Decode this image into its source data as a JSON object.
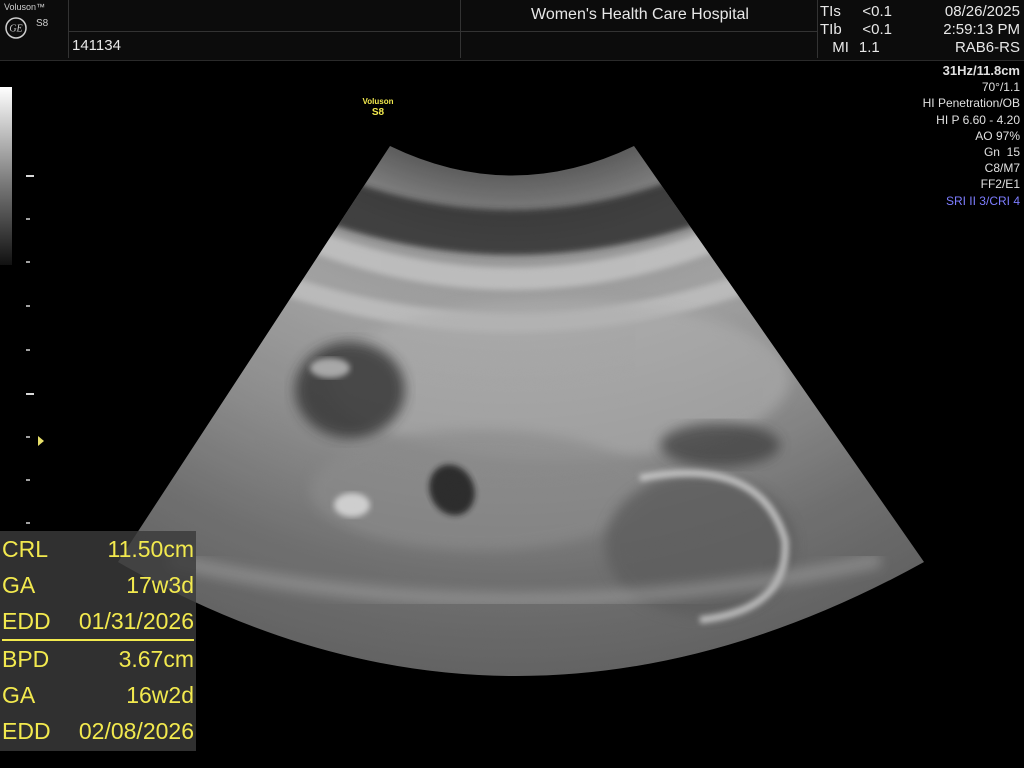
{
  "header": {
    "brand": "Voluson™",
    "model": "S8",
    "patient_id": "141134",
    "hospital": "Women's Health Care Hospital",
    "safety": [
      {
        "label": "TIs",
        "value": "<0.1"
      },
      {
        "label": "TIb",
        "value": "<0.1"
      },
      {
        "label": "MI",
        "value": "1.1"
      }
    ],
    "date": "08/26/2025",
    "time": "2:59:13 PM",
    "probe": "RAB6-RS"
  },
  "params": {
    "frame_depth": "31Hz/11.8cm",
    "angle": "70°/1.1",
    "mode": "HI Penetration/OB",
    "frequency": "HI P 6.60 - 4.20",
    "acoustic_output": "AO 97%",
    "gain": "Gn  15",
    "maps": "C8/M7",
    "filters": "FF2/E1",
    "sri": "SRI II 3/CRI 4"
  },
  "probe_label": {
    "brand": "Voluson",
    "model": "S8"
  },
  "measurements": [
    {
      "label": "CRL",
      "value": "11.50cm"
    },
    {
      "label": "GA",
      "value": "17w3d"
    },
    {
      "label": "EDD",
      "value": "01/31/2026"
    },
    {
      "label": "BPD",
      "value": "3.67cm"
    },
    {
      "label": "GA",
      "value": "16w2d"
    },
    {
      "label": "EDD",
      "value": "02/08/2026"
    }
  ],
  "colors": {
    "measurement_text": "#f2e94e",
    "sri_text": "#7d7dff",
    "focus_marker": "#e8e06a"
  },
  "icons": {
    "logo": "ge-logo-icon",
    "focus": "focus-marker-icon"
  }
}
